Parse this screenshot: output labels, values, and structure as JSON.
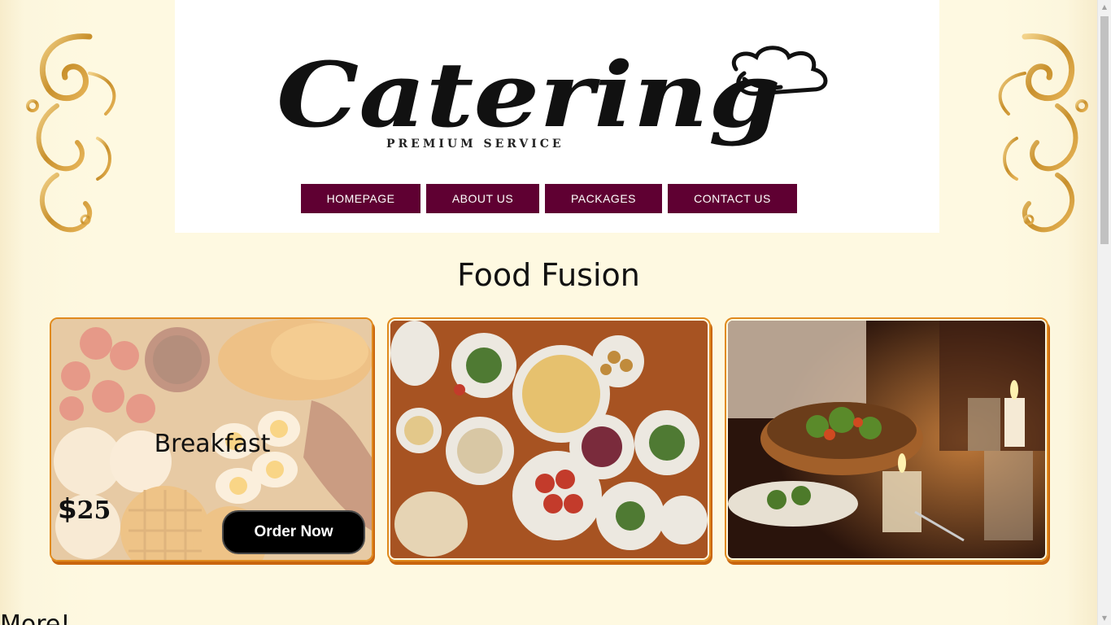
{
  "header": {
    "logo": {
      "wordmark": "Catering",
      "tagline": "PREMIUM SERVICE",
      "icon": "chef-hat-icon"
    },
    "nav": [
      {
        "label": "HOMEPAGE"
      },
      {
        "label": "ABOUT US"
      },
      {
        "label": "PACKAGES"
      },
      {
        "label": "CONTACT US"
      }
    ]
  },
  "main": {
    "title": "Food Fusion",
    "cards": [
      {
        "label": "Breakfast",
        "price_currency": "$",
        "price_amount": "25",
        "button_label": "Order Now",
        "image": "breakfast-spread-photo"
      },
      {
        "image": "shared-dishes-table-photo"
      },
      {
        "image": "candlelit-dinner-photo"
      }
    ],
    "more_title": "More!"
  },
  "colors": {
    "nav_bg": "#5f0032",
    "nav_text": "#ffffff",
    "card_border": "#e08a1e",
    "order_button_bg": "#000000",
    "page_bg": "#fef9e1"
  }
}
